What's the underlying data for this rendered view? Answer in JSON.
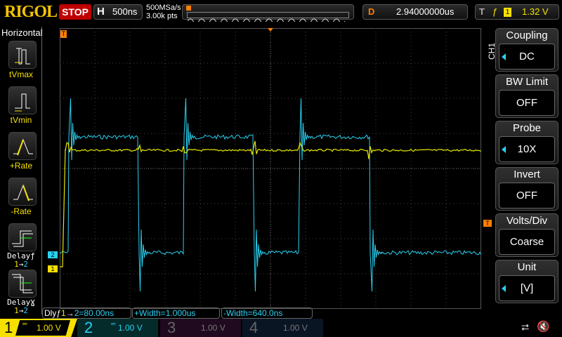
{
  "header": {
    "logo": "RIGOL",
    "run_state": "STOP",
    "h_label": "H",
    "timebase": "500ns",
    "sample_rate": "500MSa/s",
    "mem_depth": "3.00k pts",
    "d_label": "D",
    "delay": "2.94000000us",
    "t_label": "T",
    "trigger_source": "1",
    "trigger_level": "1.32 V"
  },
  "left_menu": {
    "title": "Horizontal",
    "items": [
      {
        "label": "tVmax"
      },
      {
        "label": "tVmin"
      },
      {
        "label": "+Rate"
      },
      {
        "label": "-Rate"
      },
      {
        "label": "Delayƒ",
        "sub_a": "1",
        "sub_b": "2",
        "arrow": "→"
      },
      {
        "label": "DelayƔ",
        "sub_a": "1",
        "sub_b": "2",
        "arrow": "→"
      }
    ]
  },
  "right_menu": {
    "channel": "CH1",
    "items": [
      {
        "title": "Coupling",
        "value": "DC"
      },
      {
        "title": "BW Limit",
        "value": "OFF"
      },
      {
        "title": "Probe",
        "value": "10X"
      },
      {
        "title": "Invert",
        "value": "OFF"
      },
      {
        "title": "Volts/Div",
        "value": "Coarse"
      },
      {
        "title": "Unit",
        "value": "[V]"
      }
    ]
  },
  "markers": {
    "ch1": "1",
    "ch2": "2",
    "trigger": "T"
  },
  "measurements": [
    {
      "label": "Dlyƒ",
      "a": "1",
      "arrow": "→",
      "b": "2",
      "val": "=80.00ns"
    },
    {
      "text": "+Width=1.000us"
    },
    {
      "text": "-Width=640.0ns"
    }
  ],
  "channels": [
    {
      "num": "1",
      "scale": "1.00 V",
      "color": "#f5f000"
    },
    {
      "num": "2",
      "scale": "1.00 V",
      "color": "#2ad0f0"
    },
    {
      "num": "3",
      "scale": "1.00 V",
      "color": "#555"
    },
    {
      "num": "4",
      "scale": "1.00 V",
      "color": "#555"
    }
  ],
  "colors": {
    "ch1": "#e6e600",
    "ch2": "#2ad0f0",
    "trigger": "#ff7f00"
  }
}
